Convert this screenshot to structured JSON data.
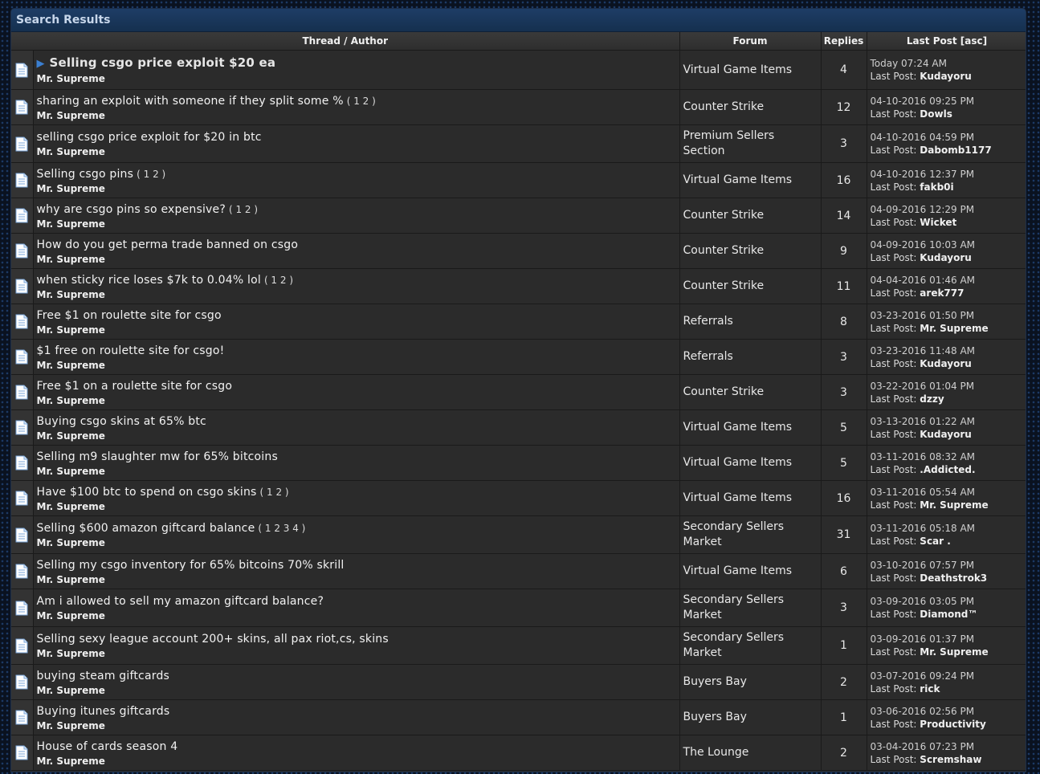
{
  "panel_title": "Search Results",
  "columns": {
    "thread": "Thread",
    "separator": " / ",
    "author": "Author",
    "forum": "Forum",
    "replies": "Replies",
    "lastpost": "Last Post",
    "sort": "[asc]"
  },
  "last_post_prefix": "Last Post: ",
  "rows": [
    {
      "title": "Selling csgo price exploit $20 ea",
      "pages": "",
      "author": "Mr. Supreme",
      "forum": "Virtual Game Items",
      "replies": "4",
      "date": "Today 07:24 AM",
      "last": "Kudayoru",
      "highlight": true
    },
    {
      "title": "sharing an exploit with someone if they split some %",
      "pages": "( 1 2 )",
      "author": "Mr. Supreme",
      "forum": "Counter Strike",
      "replies": "12",
      "date": "04-10-2016 09:25 PM",
      "last": "Dowls"
    },
    {
      "title": "selling csgo price exploit for $20 in btc",
      "pages": "",
      "author": "Mr. Supreme",
      "forum": "Premium Sellers Section",
      "replies": "3",
      "date": "04-10-2016 04:59 PM",
      "last": "Dabomb1177"
    },
    {
      "title": "Selling csgo pins",
      "pages": "( 1 2 )",
      "author": "Mr. Supreme",
      "forum": "Virtual Game Items",
      "replies": "16",
      "date": "04-10-2016 12:37 PM",
      "last": "fakb0i"
    },
    {
      "title": "why are csgo pins so expensive?",
      "pages": "( 1 2 )",
      "author": "Mr. Supreme",
      "forum": "Counter Strike",
      "replies": "14",
      "date": "04-09-2016 12:29 PM",
      "last": "Wicket"
    },
    {
      "title": "How do you get perma trade banned on csgo",
      "pages": "",
      "author": "Mr. Supreme",
      "forum": "Counter Strike",
      "replies": "9",
      "date": "04-09-2016 10:03 AM",
      "last": "Kudayoru"
    },
    {
      "title": "when sticky rice loses $7k to 0.04% lol",
      "pages": "( 1 2 )",
      "author": "Mr. Supreme",
      "forum": "Counter Strike",
      "replies": "11",
      "date": "04-04-2016 01:46 AM",
      "last": "arek777"
    },
    {
      "title": "Free $1 on roulette site for csgo",
      "pages": "",
      "author": "Mr. Supreme",
      "forum": "Referrals",
      "replies": "8",
      "date": "03-23-2016 01:50 PM",
      "last": "Mr. Supreme"
    },
    {
      "title": "$1 free on roulette site for csgo!",
      "pages": "",
      "author": "Mr. Supreme",
      "forum": "Referrals",
      "replies": "3",
      "date": "03-23-2016 11:48 AM",
      "last": "Kudayoru"
    },
    {
      "title": "Free $1 on a roulette site for csgo",
      "pages": "",
      "author": "Mr. Supreme",
      "forum": "Counter Strike",
      "replies": "3",
      "date": "03-22-2016 01:04 PM",
      "last": "dzzy"
    },
    {
      "title": "Buying csgo skins at 65% btc",
      "pages": "",
      "author": "Mr. Supreme",
      "forum": "Virtual Game Items",
      "replies": "5",
      "date": "03-13-2016 01:22 AM",
      "last": "Kudayoru"
    },
    {
      "title": "Selling m9 slaughter mw for 65% bitcoins",
      "pages": "",
      "author": "Mr. Supreme",
      "forum": "Virtual Game Items",
      "replies": "5",
      "date": "03-11-2016 08:32 AM",
      "last": ".Addicted."
    },
    {
      "title": "Have $100 btc to spend on csgo skins",
      "pages": "( 1 2 )",
      "author": "Mr. Supreme",
      "forum": "Virtual Game Items",
      "replies": "16",
      "date": "03-11-2016 05:54 AM",
      "last": "Mr. Supreme"
    },
    {
      "title": "Selling $600 amazon giftcard balance",
      "pages": "( 1 2 3 4 )",
      "author": "Mr. Supreme",
      "forum": "Secondary Sellers Market",
      "replies": "31",
      "date": "03-11-2016 05:18 AM",
      "last": "Scar ."
    },
    {
      "title": "Selling my csgo inventory for 65% bitcoins 70% skrill",
      "pages": "",
      "author": "Mr. Supreme",
      "forum": "Virtual Game Items",
      "replies": "6",
      "date": "03-10-2016 07:57 PM",
      "last": "Deathstrok3"
    },
    {
      "title": "Am i allowed to sell my amazon giftcard balance?",
      "pages": "",
      "author": "Mr. Supreme",
      "forum": "Secondary Sellers Market",
      "replies": "3",
      "date": "03-09-2016 03:05 PM",
      "last": "Diamond™"
    },
    {
      "title": "Selling sexy league account 200+ skins, all pax riot,cs, skins",
      "pages": "",
      "author": "Mr. Supreme",
      "forum": "Secondary Sellers Market",
      "replies": "1",
      "date": "03-09-2016 01:37 PM",
      "last": "Mr. Supreme"
    },
    {
      "title": "buying steam giftcards",
      "pages": "",
      "author": "Mr. Supreme",
      "forum": "Buyers Bay",
      "replies": "2",
      "date": "03-07-2016 09:24 PM",
      "last": "rick"
    },
    {
      "title": "Buying itunes giftcards",
      "pages": "",
      "author": "Mr. Supreme",
      "forum": "Buyers Bay",
      "replies": "1",
      "date": "03-06-2016 02:56 PM",
      "last": "Productivity"
    },
    {
      "title": "House of cards season 4",
      "pages": "",
      "author": "Mr. Supreme",
      "forum": "The Lounge",
      "replies": "2",
      "date": "03-04-2016 07:23 PM",
      "last": "Scremshaw"
    }
  ]
}
